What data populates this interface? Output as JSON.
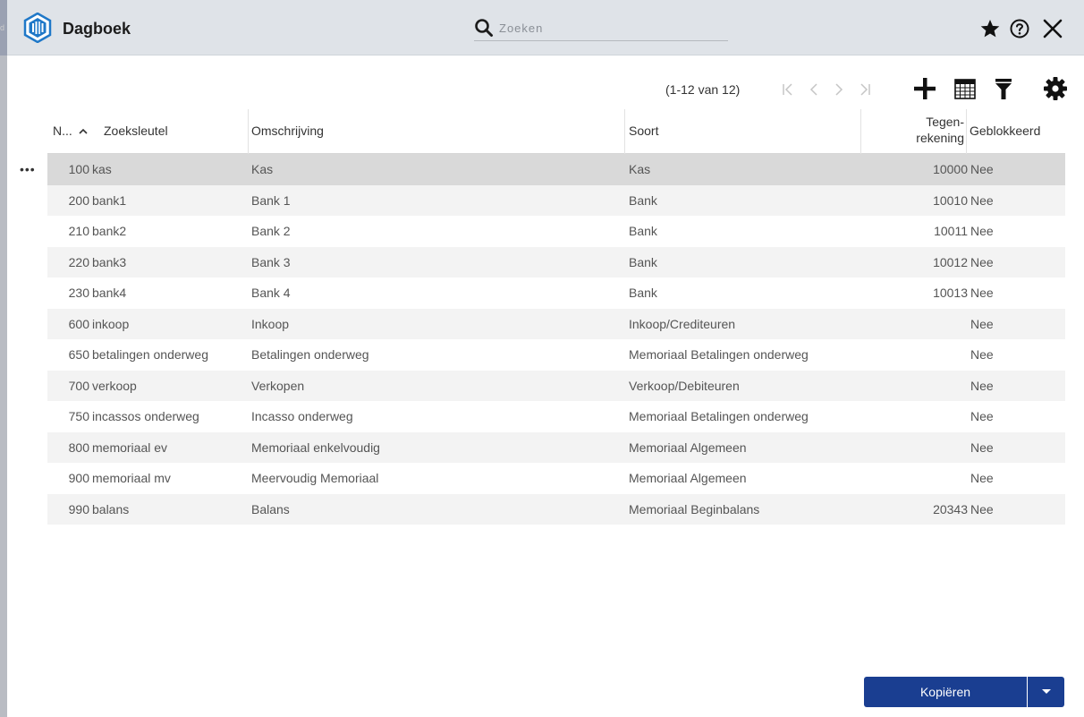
{
  "app": {
    "title": "Dagboek",
    "edge_letter": "d"
  },
  "search": {
    "placeholder": "Zoeken",
    "value": ""
  },
  "header_icons": [
    "star-icon",
    "help-icon",
    "close-icon"
  ],
  "toolbar": {
    "page_info": "(1-12 van 12)",
    "icons": [
      "first-page-icon",
      "prev-page-icon",
      "next-page-icon",
      "last-page-icon",
      "add-icon",
      "calendar-icon",
      "filter-icon",
      "settings-icon"
    ]
  },
  "table": {
    "columns": {
      "nr": "N...",
      "key": "Zoeksleutel",
      "oms": "Omschrijving",
      "soort": "Soort",
      "tegen_1": "Tegen-",
      "tegen_2": "rekening",
      "geblokkeerd": "Geblokkeerd"
    },
    "sort": {
      "column": "nr",
      "direction": "ascending"
    },
    "rows": [
      {
        "nr": "100",
        "key": "kas",
        "oms": "Kas",
        "soort": "Kas",
        "tegen": "10000",
        "blk": "Nee"
      },
      {
        "nr": "200",
        "key": "bank1",
        "oms": "Bank 1",
        "soort": "Bank",
        "tegen": "10010",
        "blk": "Nee"
      },
      {
        "nr": "210",
        "key": "bank2",
        "oms": "Bank 2",
        "soort": "Bank",
        "tegen": "10011",
        "blk": "Nee"
      },
      {
        "nr": "220",
        "key": "bank3",
        "oms": "Bank 3",
        "soort": "Bank",
        "tegen": "10012",
        "blk": "Nee"
      },
      {
        "nr": "230",
        "key": "bank4",
        "oms": "Bank 4",
        "soort": "Bank",
        "tegen": "10013",
        "blk": "Nee"
      },
      {
        "nr": "600",
        "key": "inkoop",
        "oms": "Inkoop",
        "soort": "Inkoop/Crediteuren",
        "tegen": "",
        "blk": "Nee"
      },
      {
        "nr": "650",
        "key": "betalingen onderweg",
        "oms": "Betalingen onderweg",
        "soort": "Memoriaal Betalingen onderweg",
        "tegen": "",
        "blk": "Nee"
      },
      {
        "nr": "700",
        "key": "verkoop",
        "oms": "Verkopen",
        "soort": "Verkoop/Debiteuren",
        "tegen": "",
        "blk": "Nee"
      },
      {
        "nr": "750",
        "key": "incassos onderweg",
        "oms": "Incasso onderweg",
        "soort": "Memoriaal Betalingen onderweg",
        "tegen": "",
        "blk": "Nee"
      },
      {
        "nr": "800",
        "key": "memoriaal ev",
        "oms": "Memoriaal enkelvoudig",
        "soort": "Memoriaal Algemeen",
        "tegen": "",
        "blk": "Nee"
      },
      {
        "nr": "900",
        "key": "memoriaal mv",
        "oms": "Meervoudig Memoriaal",
        "soort": "Memoriaal Algemeen",
        "tegen": "",
        "blk": "Nee"
      },
      {
        "nr": "990",
        "key": "balans",
        "oms": "Balans",
        "soort": "Memoriaal Beginbalans",
        "tegen": "20343",
        "blk": "Nee"
      }
    ],
    "selected_row_index": 0,
    "row_menu_label": "•••"
  },
  "actions": {
    "copy_label": "Kopiëren"
  },
  "colors": {
    "header_bg": "#dfe3e8",
    "primary_button": "#1a3e91",
    "selected_row": "#d9d9d9",
    "logo_blue": "#1f78c8"
  }
}
